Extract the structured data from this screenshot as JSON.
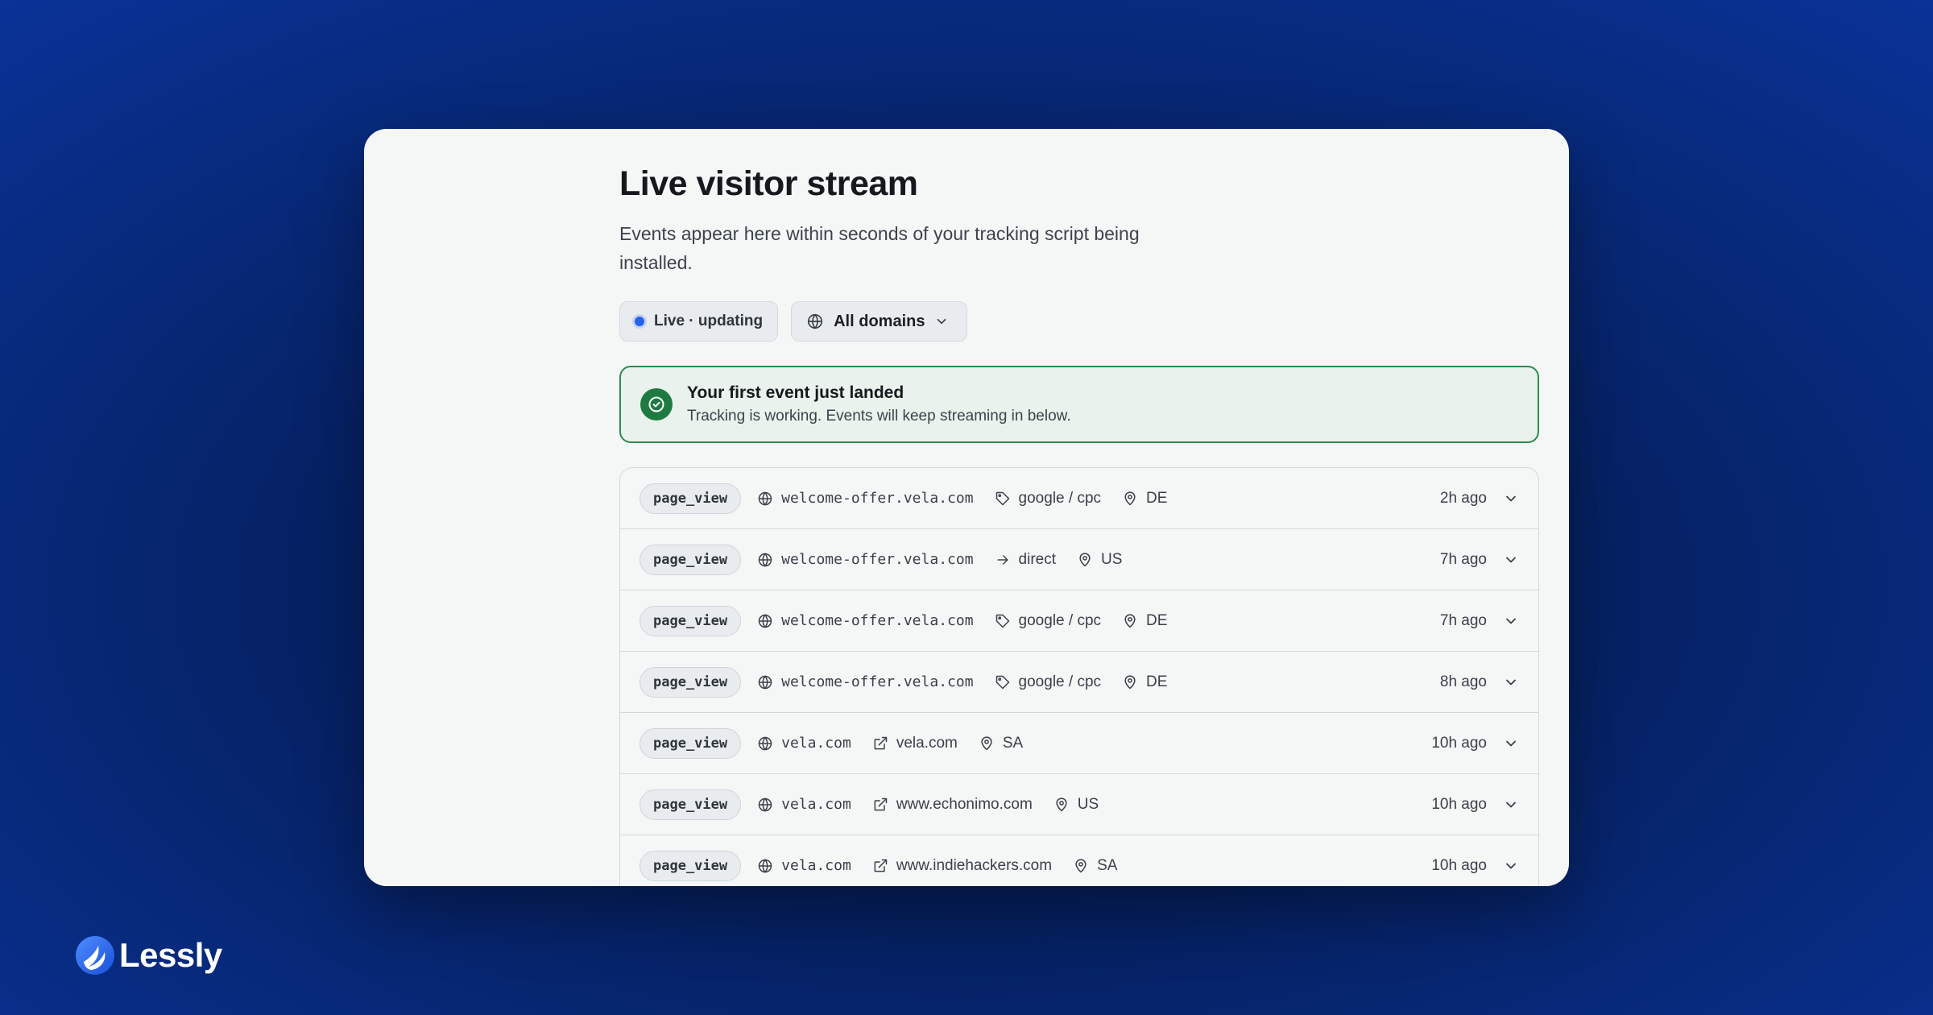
{
  "page": {
    "title": "Live visitor stream",
    "subtitle": "Events appear here within seconds of your tracking script being installed."
  },
  "controls": {
    "live_label": "Live · updating",
    "domain_label": "All domains"
  },
  "banner": {
    "title": "Your first event just landed",
    "text": "Tracking is working. Events will keep streaming in below."
  },
  "events": [
    {
      "event": "page_view",
      "domain": "welcome-offer.vela.com",
      "source_icon": "tag-icon",
      "source": "google / cpc",
      "country": "DE",
      "time": "2h ago"
    },
    {
      "event": "page_view",
      "domain": "welcome-offer.vela.com",
      "source_icon": "arrow-right-icon",
      "source": "direct",
      "country": "US",
      "time": "7h ago"
    },
    {
      "event": "page_view",
      "domain": "welcome-offer.vela.com",
      "source_icon": "tag-icon",
      "source": "google / cpc",
      "country": "DE",
      "time": "7h ago"
    },
    {
      "event": "page_view",
      "domain": "welcome-offer.vela.com",
      "source_icon": "tag-icon",
      "source": "google / cpc",
      "country": "DE",
      "time": "8h ago"
    },
    {
      "event": "page_view",
      "domain": "vela.com",
      "source_icon": "external-link-icon",
      "source": "vela.com",
      "country": "SA",
      "time": "10h ago"
    },
    {
      "event": "page_view",
      "domain": "vela.com",
      "source_icon": "external-link-icon",
      "source": "www.echonimo.com",
      "country": "US",
      "time": "10h ago"
    },
    {
      "event": "page_view",
      "domain": "vela.com",
      "source_icon": "external-link-icon",
      "source": "www.indiehackers.com",
      "country": "SA",
      "time": "10h ago"
    }
  ],
  "brand": {
    "name": "Lessly",
    "accent": "#2563eb",
    "success": "#1f7a42"
  }
}
